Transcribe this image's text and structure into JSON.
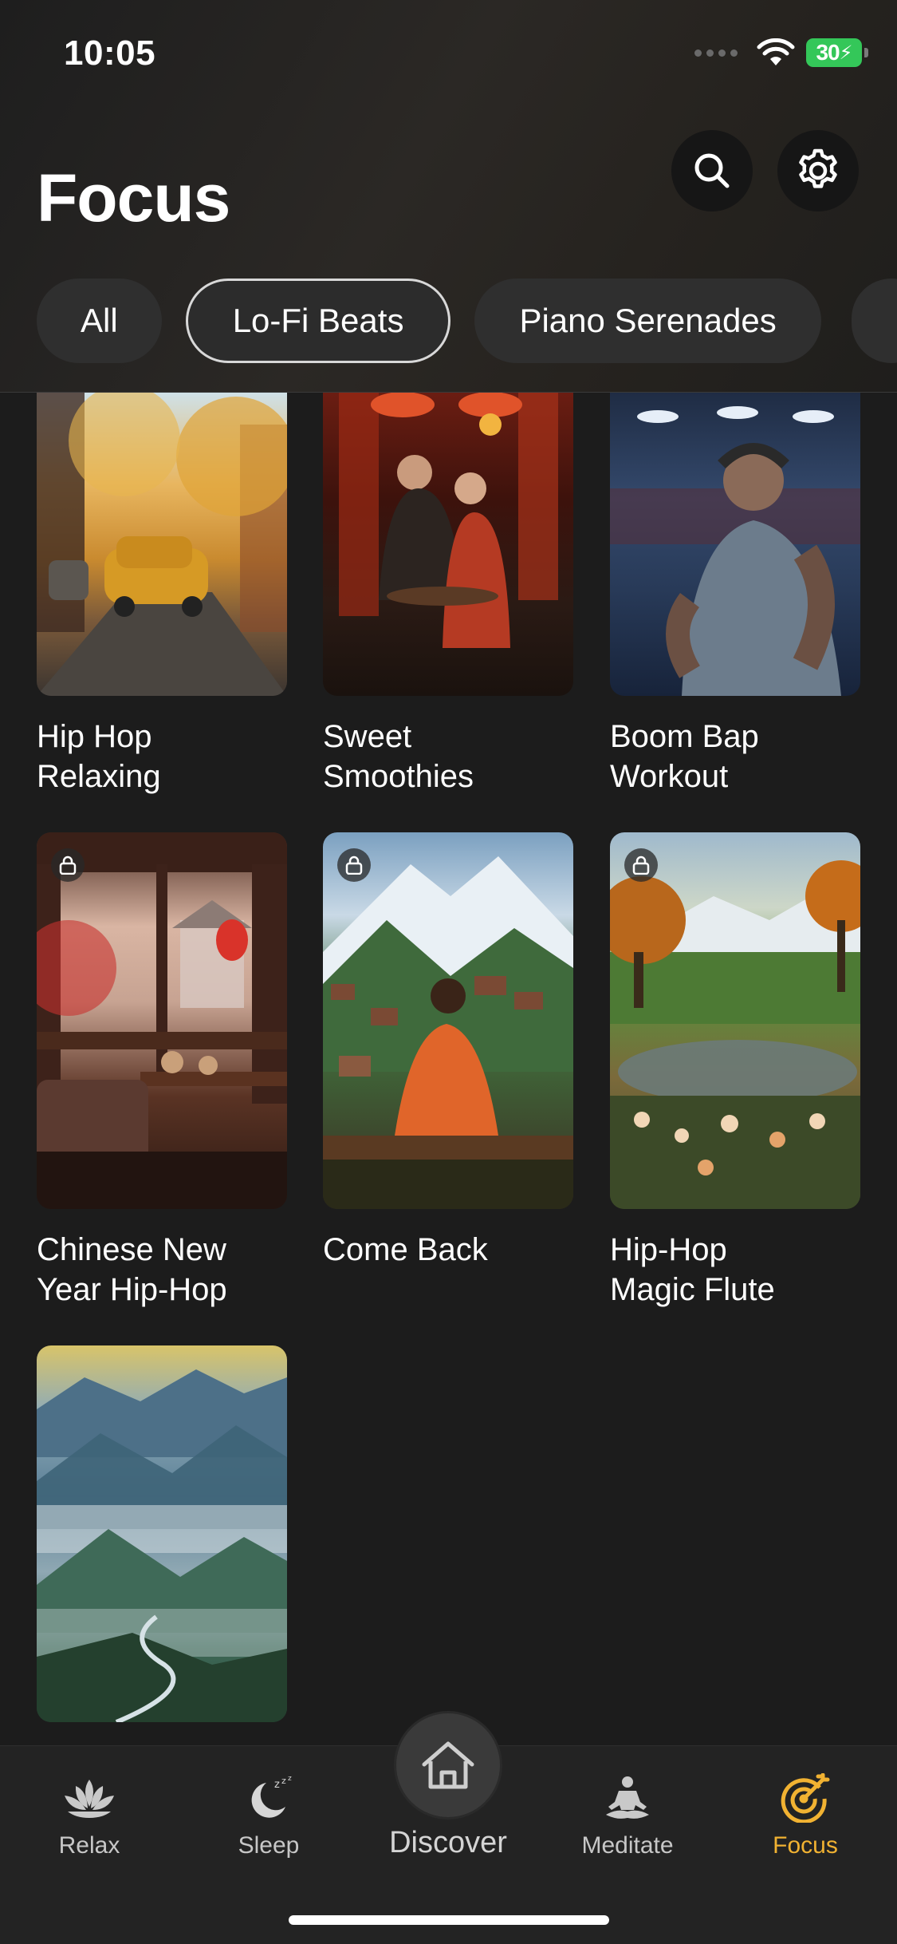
{
  "status_bar": {
    "time": "10:05",
    "battery": "30"
  },
  "header": {
    "title": "Focus",
    "chips": [
      {
        "label": "All"
      },
      {
        "label": "Lo-Fi Beats"
      },
      {
        "label": "Piano Serenades"
      }
    ],
    "active_chip": "Lo-Fi Beats"
  },
  "tracks": [
    {
      "title": "Hip Hop\nRelaxing",
      "locked": false
    },
    {
      "title": "Sweet\nSmoothies",
      "locked": false
    },
    {
      "title": "Boom Bap\nWorkout",
      "locked": false
    },
    {
      "title": "Chinese New\nYear Hip-Hop",
      "locked": true
    },
    {
      "title": "Come Back",
      "locked": true
    },
    {
      "title": "Hip-Hop\nMagic Flute",
      "locked": true
    },
    {
      "title": "",
      "locked": false
    }
  ],
  "tab_bar": {
    "tabs": [
      {
        "label": "Relax",
        "icon": "lotus-icon"
      },
      {
        "label": "Sleep",
        "icon": "moon-icon"
      },
      {
        "label": "Discover",
        "icon": "home-icon"
      },
      {
        "label": "Meditate",
        "icon": "meditate-icon"
      },
      {
        "label": "Focus",
        "icon": "target-icon"
      }
    ],
    "active_tab": "Focus",
    "active_color": "#f1b232"
  }
}
